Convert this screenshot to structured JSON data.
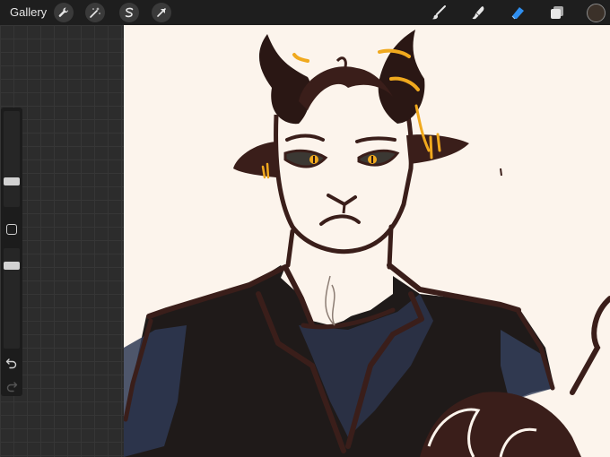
{
  "topbar": {
    "gallery_label": "Gallery",
    "left_tools": [
      "wrench-icon",
      "magic-wand-icon",
      "selection-icon",
      "transform-arrow-icon"
    ],
    "right_tools": [
      "brush-icon",
      "smudge-icon",
      "eraser-icon",
      "layers-icon"
    ],
    "active_tool": "eraser-icon",
    "active_tool_color": "#2f8ff0",
    "current_color": "#3b3129"
  },
  "sidebar": {
    "brush_size_level": 0.76,
    "opacity_level": 0.15,
    "controls": [
      "brush-size-slider",
      "modify-button",
      "opacity-slider",
      "undo-button",
      "redo-button"
    ]
  },
  "canvas": {
    "background_color": "#fcf4ec",
    "stroke_color": "#3a1e1a",
    "accent_color": "#f0a91e",
    "shirt_color": "#2a3044"
  }
}
